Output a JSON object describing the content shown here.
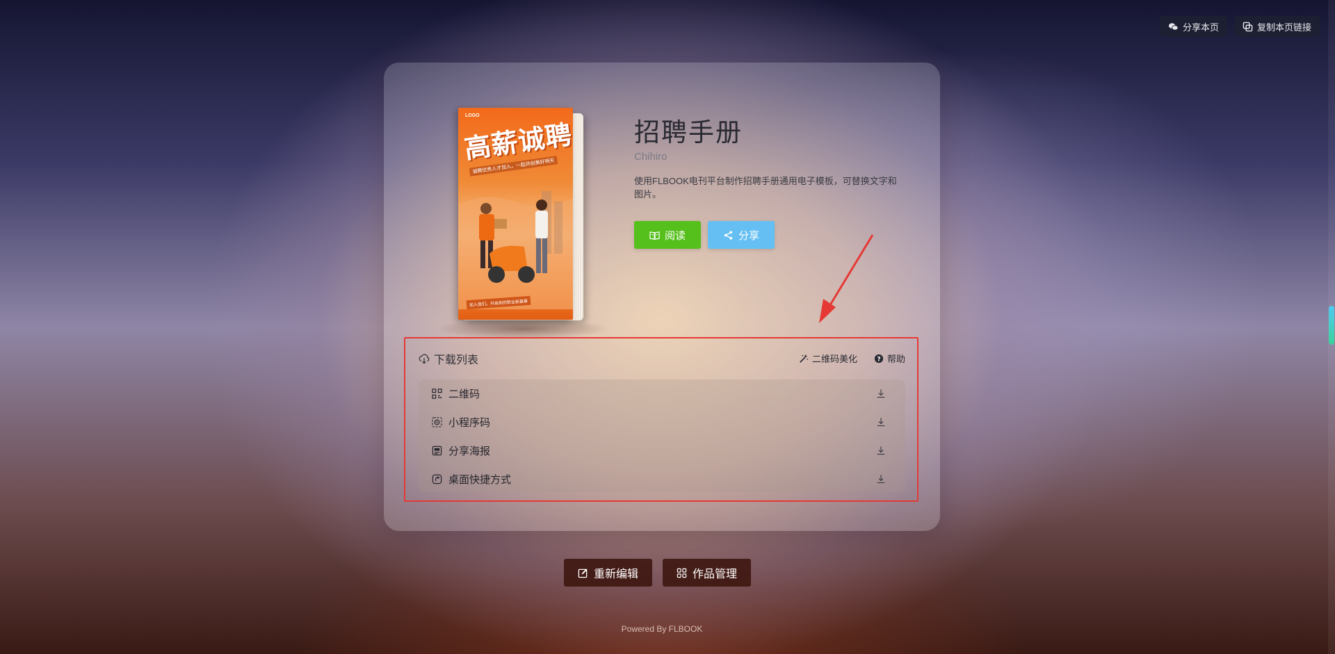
{
  "top_actions": {
    "share_page": "分享本页",
    "copy_link": "复制本页链接"
  },
  "book": {
    "title": "招聘手册",
    "author": "Chihiro",
    "description": "使用FLBOOK电刊平台制作招聘手册通用电子模板，可替换文字和图片。",
    "cover": {
      "logo": "LOGO",
      "title": "高薪诚聘",
      "subtitle": "诚聘优秀人才加入，一起共创美好明天",
      "bottom": "加入我们，开启你的职业新篇章"
    }
  },
  "actions": {
    "read": "阅读",
    "share": "分享"
  },
  "download": {
    "heading": "下载列表",
    "qr_beautify": "二维码美化",
    "help": "帮助",
    "items": [
      {
        "label": "二维码",
        "icon": "qrcode-icon"
      },
      {
        "label": "小程序码",
        "icon": "miniprogram-code-icon"
      },
      {
        "label": "分享海报",
        "icon": "poster-icon"
      },
      {
        "label": "桌面快捷方式",
        "icon": "shortcut-icon"
      }
    ]
  },
  "bottom_actions": {
    "edit": "重新编辑",
    "manage": "作品管理"
  },
  "footer": {
    "powered": "Powered By FLBOOK"
  },
  "colors": {
    "read_button": "#55bf1c",
    "share_button": "#66bff2",
    "highlight_frame": "#e53935",
    "bottom_button": "#3c140e"
  }
}
